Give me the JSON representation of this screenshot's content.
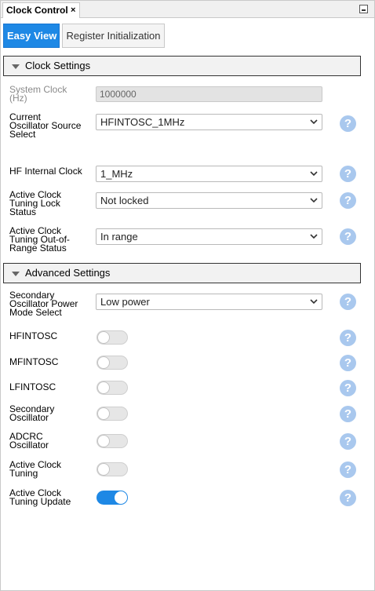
{
  "window": {
    "tab_title": "Clock Control",
    "tab_close": "×"
  },
  "views": {
    "easy_view": "Easy View",
    "register_init": "Register Initialization"
  },
  "clock_settings": {
    "header": "Clock Settings",
    "system_clock_label": "System Clock\n(Hz)",
    "system_clock_value": "1000000",
    "osc_source_label": "Current\nOscillator Source\nSelect",
    "osc_source_value": "HFINTOSC_1MHz",
    "hf_internal_label": "HF Internal Clock",
    "hf_internal_value": "1_MHz",
    "tuning_lock_label": "Active Clock\nTuning Lock\nStatus",
    "tuning_lock_value": "Not locked",
    "tuning_range_label": "Active Clock\nTuning Out-of-\nRange Status",
    "tuning_range_value": "In range"
  },
  "advanced_settings": {
    "header": "Advanced Settings",
    "sec_osc_power_label": "Secondary\nOscillator Power\nMode Select",
    "sec_osc_power_value": "Low power",
    "toggles": [
      {
        "label": "HFINTOSC",
        "on": false
      },
      {
        "label": "MFINTOSC",
        "on": false
      },
      {
        "label": "LFINTOSC",
        "on": false
      },
      {
        "label": "Secondary\nOscillator",
        "on": false
      },
      {
        "label": "ADCRC\nOscillator",
        "on": false
      },
      {
        "label": "Active Clock\nTuning",
        "on": false
      },
      {
        "label": "Active Clock\nTuning Update",
        "on": true
      }
    ]
  },
  "help_glyph": "?",
  "colors": {
    "accent": "#1e88e5",
    "help": "#a9c8ee"
  }
}
